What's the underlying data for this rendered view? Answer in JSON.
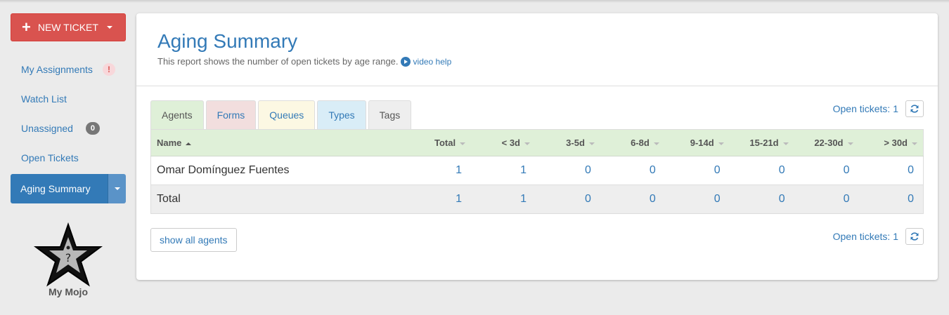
{
  "sidebar": {
    "new_ticket_label": "NEW TICKET",
    "items": [
      {
        "label": "My Assignments",
        "badge": "!"
      },
      {
        "label": "Watch List"
      },
      {
        "label": "Unassigned",
        "badge": "0"
      },
      {
        "label": "Open Tickets"
      }
    ],
    "active_item": "Aging Summary",
    "mojo_label": "My Mojo"
  },
  "header": {
    "title": "Aging Summary",
    "subtitle": "This report shows the number of open tickets by age range.",
    "video_help": "video help"
  },
  "tabs": [
    "Agents",
    "Forms",
    "Queues",
    "Types",
    "Tags"
  ],
  "open_tickets_label": "Open tickets: 1",
  "table": {
    "columns": [
      "Name",
      "Total",
      "< 3d",
      "3-5d",
      "6-8d",
      "9-14d",
      "15-21d",
      "22-30d",
      "> 30d"
    ],
    "rows": [
      [
        "Omar Domínguez Fuentes",
        "1",
        "1",
        "0",
        "0",
        "0",
        "0",
        "0",
        "0"
      ],
      [
        "Total",
        "1",
        "1",
        "0",
        "0",
        "0",
        "0",
        "0",
        "0"
      ]
    ]
  },
  "show_all_label": "show all agents",
  "colors": {
    "primary": "#337ab7",
    "danger": "#d9534f",
    "header_green": "#dff0d8"
  },
  "icons": [
    "plus-icon",
    "caret-down-icon",
    "play-icon",
    "refresh-icon",
    "star-question-icon"
  ]
}
